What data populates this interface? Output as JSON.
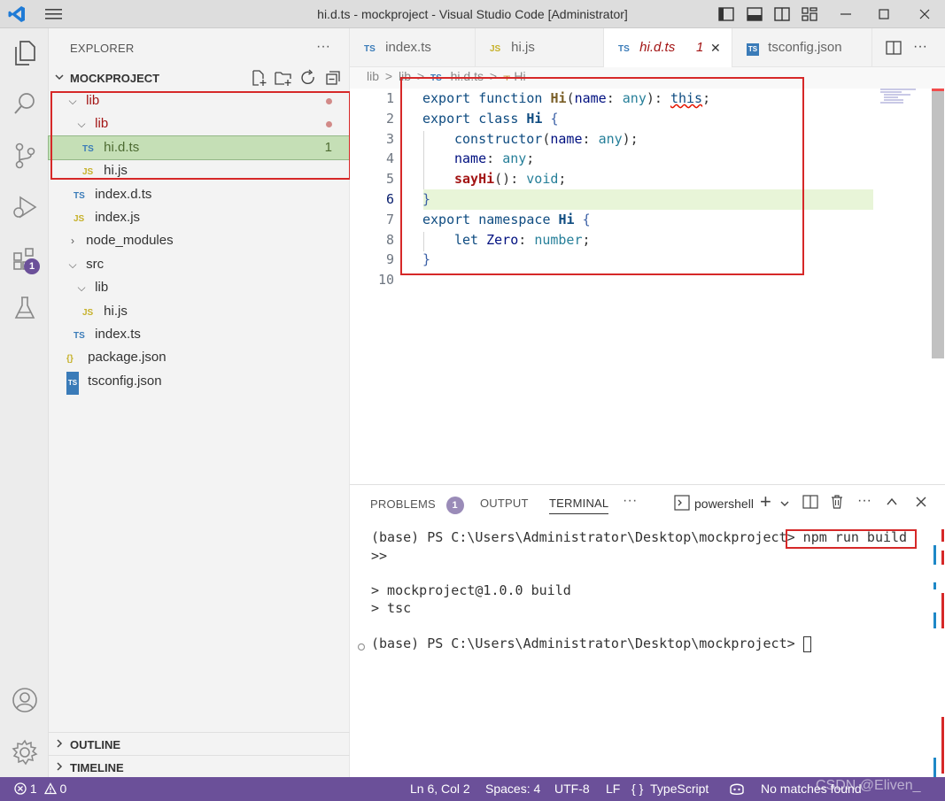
{
  "window": {
    "title": "hi.d.ts - mockproject - Visual Studio Code [Administrator]"
  },
  "colors": {
    "accent": "#6b5099",
    "statusbar": "#6b5099",
    "highlight_box": "#d62828",
    "line_highlight": "#e8f5d8"
  },
  "activity_bar": {
    "items": [
      "explorer-icon",
      "search-icon",
      "source-control-icon",
      "run-debug-icon",
      "extensions-icon",
      "testing-icon"
    ],
    "extensions_badge": "1",
    "bottom": [
      "account-icon",
      "settings-gear-icon"
    ]
  },
  "sidebar": {
    "title": "EXPLORER",
    "more": "···",
    "project": "MOCKPROJECT",
    "tree": [
      {
        "label": "lib",
        "kind": "folder",
        "expanded": true
      },
      {
        "label": "lib",
        "kind": "folder",
        "expanded": true
      },
      {
        "label": "hi.d.ts",
        "kind": "ts",
        "badge": "1"
      },
      {
        "label": "hi.js",
        "kind": "js"
      },
      {
        "label": "index.d.ts",
        "kind": "ts"
      },
      {
        "label": "index.js",
        "kind": "js"
      },
      {
        "label": "node_modules",
        "kind": "folder",
        "expanded": false
      },
      {
        "label": "src",
        "kind": "folder",
        "expanded": true
      },
      {
        "label": "lib",
        "kind": "folder",
        "expanded": true
      },
      {
        "label": "hi.js",
        "kind": "js"
      },
      {
        "label": "index.ts",
        "kind": "ts"
      },
      {
        "label": "package.json",
        "kind": "json"
      },
      {
        "label": "tsconfig.json",
        "kind": "tsconfig"
      }
    ],
    "icons": {
      "ts": "TS",
      "js": "JS",
      "json": "{}",
      "tsconfig": "TS"
    },
    "outline": "OUTLINE",
    "timeline": "TIMELINE"
  },
  "tabs": [
    {
      "icon": "TS",
      "label": "index.ts"
    },
    {
      "icon": "JS",
      "label": "hi.js"
    },
    {
      "icon": "TS",
      "label": "hi.d.ts",
      "badge": "1",
      "close": "✕"
    },
    {
      "icon": "TS",
      "label": "tsconfig.json"
    }
  ],
  "breadcrumb": {
    "seg1": "lib",
    "seg2": "lib",
    "seg3_icon": "TS",
    "seg3": "hi.d.ts",
    "seg4": "Hi",
    "sep": ">"
  },
  "editor": {
    "line_numbers": [
      "1",
      "2",
      "3",
      "4",
      "5",
      "6",
      "7",
      "8",
      "9",
      "10"
    ],
    "lines": {
      "l1": {
        "kw1": "export",
        "kw2": "function",
        "name": "Hi",
        "p1": "(",
        "param": "name",
        "colon": ":",
        "type": "any",
        "p2": "):",
        "this": "this",
        "semi": ";"
      },
      "l2": {
        "kw1": "export",
        "kw2": "class",
        "name": "Hi",
        "brace": "{"
      },
      "l3": {
        "kw": "constructor",
        "p1": "(",
        "param": "name",
        "colon": ":",
        "type": "any",
        "p2": ");"
      },
      "l4": {
        "param": "name",
        "colon": ":",
        "type": "any",
        "semi": ";"
      },
      "l5": {
        "name": "sayHi",
        "p": "():",
        "type": "void",
        "semi": ";"
      },
      "l6": {
        "brace": "}"
      },
      "l7": {
        "kw1": "export",
        "kw2": "namespace",
        "name": "Hi",
        "brace": "{"
      },
      "l8": {
        "kw": "let",
        "param": "Zero",
        "colon": ":",
        "type": "number",
        "semi": ";"
      },
      "l9": {
        "brace": "}"
      }
    }
  },
  "panel": {
    "tabs": {
      "problems": "PROBLEMS",
      "problems_badge": "1",
      "output": "OUTPUT",
      "terminal": "TERMINAL",
      "more": "···"
    },
    "shell": "powershell",
    "terminal": {
      "line1_prompt": "(base) PS C:\\Users\\Administrator\\Desktop\\mockproject>",
      "line1_cmd": "npm run build",
      "line2": ">>",
      "line3": "> mockproject@1.0.0 build",
      "line4": "> tsc",
      "line5_prompt": "(base) PS C:\\Users\\Administrator\\Desktop\\mockproject>"
    }
  },
  "statusbar": {
    "errors": "1",
    "warnings": "0",
    "position": "Ln 6, Col 2",
    "spaces": "Spaces: 4",
    "encoding": "UTF-8",
    "eol": "LF",
    "language_icon": "{ }",
    "language": "TypeScript",
    "search": "No matches found",
    "watermark": "CSDN @Eliven_"
  }
}
